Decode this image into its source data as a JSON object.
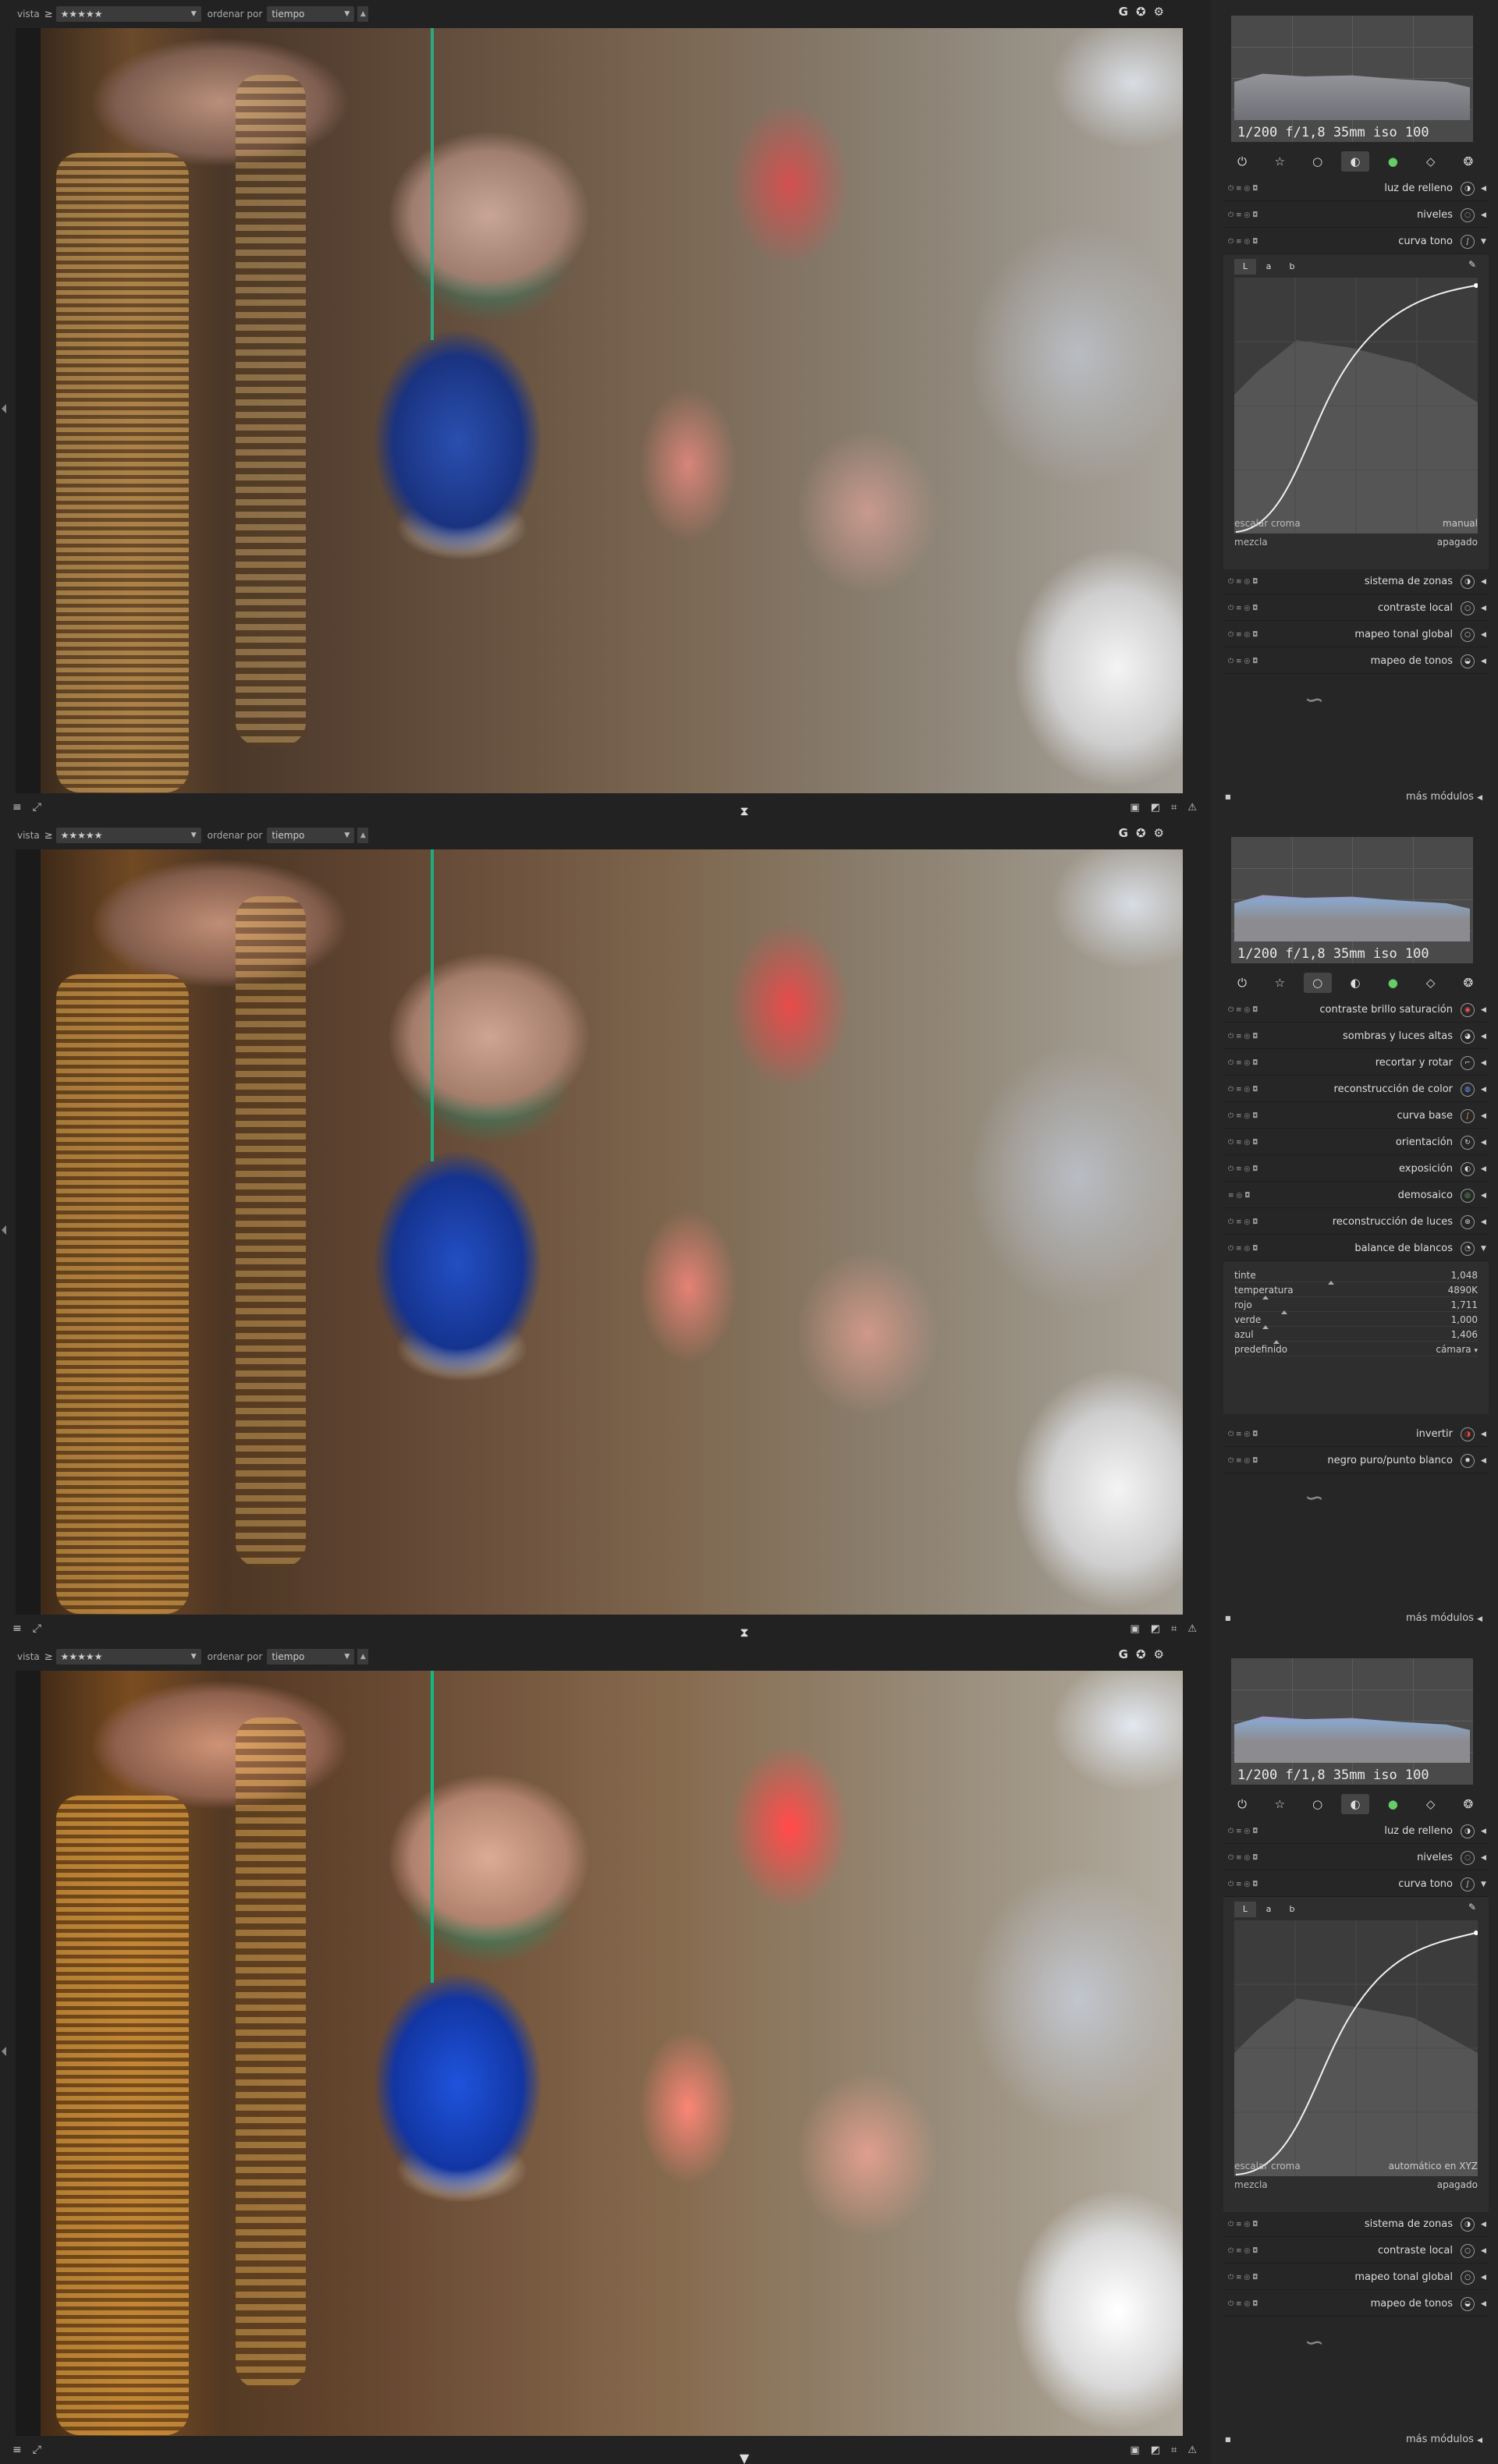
{
  "panels": [
    {
      "id": "p1",
      "topbar": {
        "vista_label": "vista",
        "rating_op": "≥",
        "rating": "★★★★★",
        "sort_label": "ordenar por",
        "sort_value": "tiempo"
      },
      "exif": "1/200 f/1,8 35mm iso 100",
      "modules_top": [
        {
          "name": "luz de relleno"
        },
        {
          "name": "niveles"
        },
        {
          "name": "curva tono"
        }
      ],
      "curve": {
        "tabs": [
          "L",
          "a",
          "b"
        ],
        "row1_label": "escalar croma",
        "row1_value": "manual",
        "row2_label": "mezcla",
        "row2_value": "apagado"
      },
      "modules_bottom": [
        {
          "name": "sistema de zonas"
        },
        {
          "name": "contraste local"
        },
        {
          "name": "mapeo tonal global"
        },
        {
          "name": "mapeo de tonos"
        }
      ],
      "more": "más módulos"
    },
    {
      "id": "p2",
      "topbar": {
        "vista_label": "vista",
        "rating_op": "≥",
        "rating": "★★★★★",
        "sort_label": "ordenar por",
        "sort_value": "tiempo"
      },
      "exif": "1/200 f/1,8 35mm iso 100",
      "modules_top": [
        {
          "name": "contraste brillo saturación"
        },
        {
          "name": "sombras y luces altas"
        },
        {
          "name": "recortar y rotar"
        },
        {
          "name": "reconstrucción de color"
        },
        {
          "name": "curva base"
        },
        {
          "name": "orientación"
        },
        {
          "name": "exposición"
        },
        {
          "name": "demosaico"
        },
        {
          "name": "reconstrucción de luces"
        },
        {
          "name": "balance de blancos"
        }
      ],
      "wb": [
        {
          "label": "tinte",
          "value": "1,048"
        },
        {
          "label": "temperatura",
          "value": "4890K"
        },
        {
          "label": "rojo",
          "value": "1,711"
        },
        {
          "label": "verde",
          "value": "1,000"
        },
        {
          "label": "azul",
          "value": "1,406"
        },
        {
          "label": "predefinido",
          "value": "cámara"
        }
      ],
      "modules_bottom": [
        {
          "name": "invertir"
        },
        {
          "name": "negro puro/punto blanco"
        }
      ],
      "more": "más módulos"
    },
    {
      "id": "p3",
      "topbar": {
        "vista_label": "vista",
        "rating_op": "≥",
        "rating": "★★★★★",
        "sort_label": "ordenar por",
        "sort_value": "tiempo"
      },
      "exif": "1/200 f/1,8 35mm iso 100",
      "modules_top": [
        {
          "name": "luz de relleno"
        },
        {
          "name": "niveles"
        },
        {
          "name": "curva tono"
        }
      ],
      "curve": {
        "tabs": [
          "L",
          "a",
          "b"
        ],
        "row1_label": "escalar croma",
        "row1_value": "automático en XYZ",
        "row2_label": "mezcla",
        "row2_value": "apagado"
      },
      "modules_bottom": [
        {
          "name": "sistema de zonas"
        },
        {
          "name": "contraste local"
        },
        {
          "name": "mapeo tonal global"
        },
        {
          "name": "mapeo de tonos"
        }
      ],
      "more": "más módulos"
    }
  ],
  "icons": {
    "menu": "menu-icon",
    "expand": "expand-icon",
    "collapse": "collapse-icon",
    "grp": "G",
    "star": "star-icon",
    "gear": "gear-icon"
  }
}
